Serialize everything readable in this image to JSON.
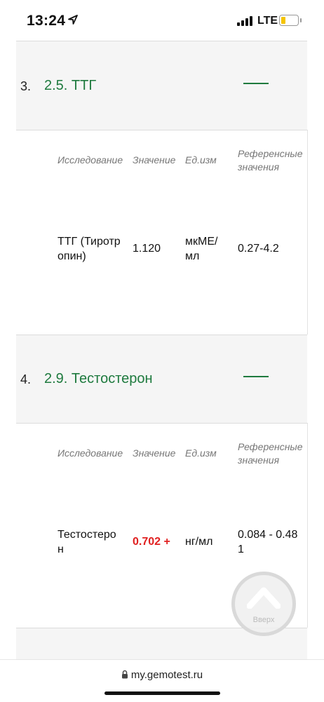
{
  "status": {
    "time": "13:24",
    "network": "LTE",
    "battery_level": 0.2
  },
  "columns": {
    "study": "Исследование",
    "value": "Значение",
    "unit": "Ед.изм",
    "reference_line1": "Референсные",
    "reference_line2": "значения"
  },
  "sections": [
    {
      "number": "3.",
      "title": "2.5. ТТГ",
      "row": {
        "name_line1": "ТТГ (Тиротр",
        "name_line2": "опин)",
        "value": "1.120",
        "unit_line1": "мкМЕ/",
        "unit_line2": "мл",
        "reference_line1": "0.27-4.2",
        "reference_line2": ""
      }
    },
    {
      "number": "4.",
      "title": "2.9. Тестостерон",
      "row": {
        "name_line1": "Тестостеро",
        "name_line2": "н",
        "value": "0.702 +",
        "unit_line1": "нг/мл",
        "unit_line2": "",
        "reference_line1": "0.084 - 0.48",
        "reference_line2": "1"
      }
    }
  ],
  "scroll_up": {
    "label": "Вверх"
  },
  "browser": {
    "url": "my.gemotest.ru"
  },
  "colors": {
    "section_title": "#1e7a3e",
    "highlight_value": "#e02020",
    "header_bg": "#f5f5f5"
  }
}
